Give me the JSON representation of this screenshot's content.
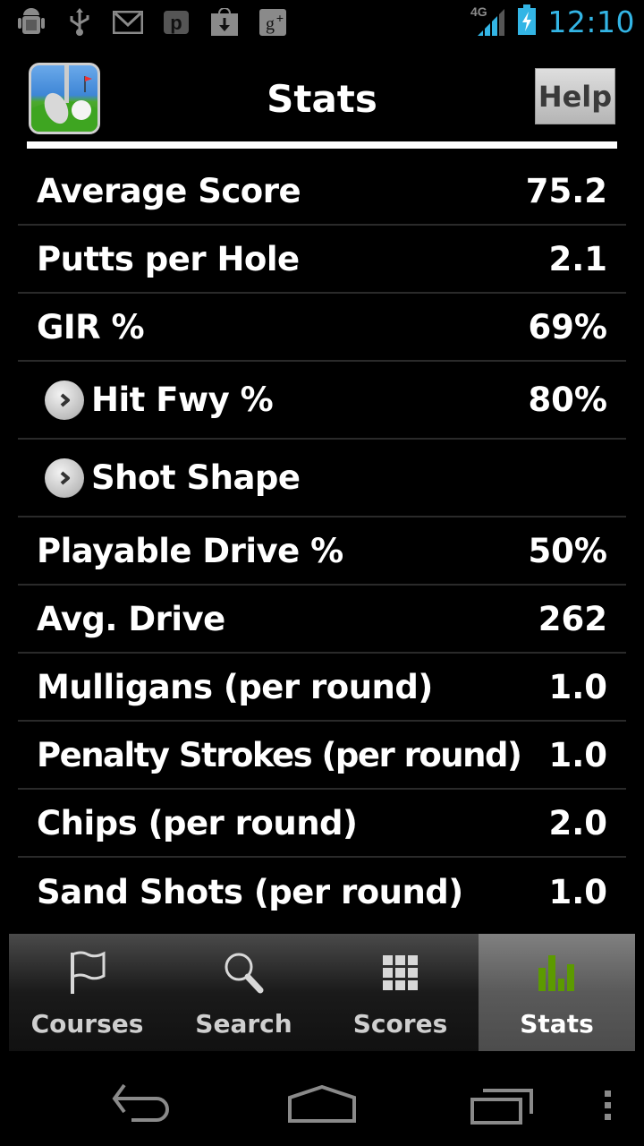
{
  "status_bar": {
    "notification_icons": [
      "android-debug-icon",
      "usb-icon",
      "gmail-icon",
      "p-app-icon",
      "download-icon",
      "google-plus-icon"
    ],
    "network": "4G",
    "battery": "charging",
    "time": "12:10"
  },
  "header": {
    "title": "Stats",
    "help_label": "Help"
  },
  "stats": [
    {
      "label": "Average Score",
      "value": "75.2",
      "expandable": false
    },
    {
      "label": "Putts per Hole",
      "value": "2.1",
      "expandable": false
    },
    {
      "label": "GIR %",
      "value": "69%",
      "expandable": false
    },
    {
      "label": "Hit Fwy %",
      "value": "80%",
      "expandable": true
    },
    {
      "label": "Shot Shape",
      "value": "",
      "expandable": true
    },
    {
      "label": "Playable Drive %",
      "value": "50%",
      "expandable": false
    },
    {
      "label": "Avg. Drive",
      "value": "262",
      "expandable": false
    },
    {
      "label": "Mulligans (per round)",
      "value": "1.0",
      "expandable": false
    },
    {
      "label": "Penalty Strokes (per round)",
      "value": "1.0",
      "expandable": false
    },
    {
      "label": "Chips (per round)",
      "value": "2.0",
      "expandable": false
    },
    {
      "label": "Sand Shots (per round)",
      "value": "1.0",
      "expandable": false
    }
  ],
  "tabs": [
    {
      "label": "Courses",
      "icon": "flag-icon",
      "active": false
    },
    {
      "label": "Search",
      "icon": "search-icon",
      "active": false
    },
    {
      "label": "Scores",
      "icon": "grid-icon",
      "active": false
    },
    {
      "label": "Stats",
      "icon": "bar-chart-icon",
      "active": true
    }
  ],
  "colors": {
    "clock": "#33b5e5",
    "active_tab_icon": "#5c9a00",
    "background": "#000000"
  }
}
